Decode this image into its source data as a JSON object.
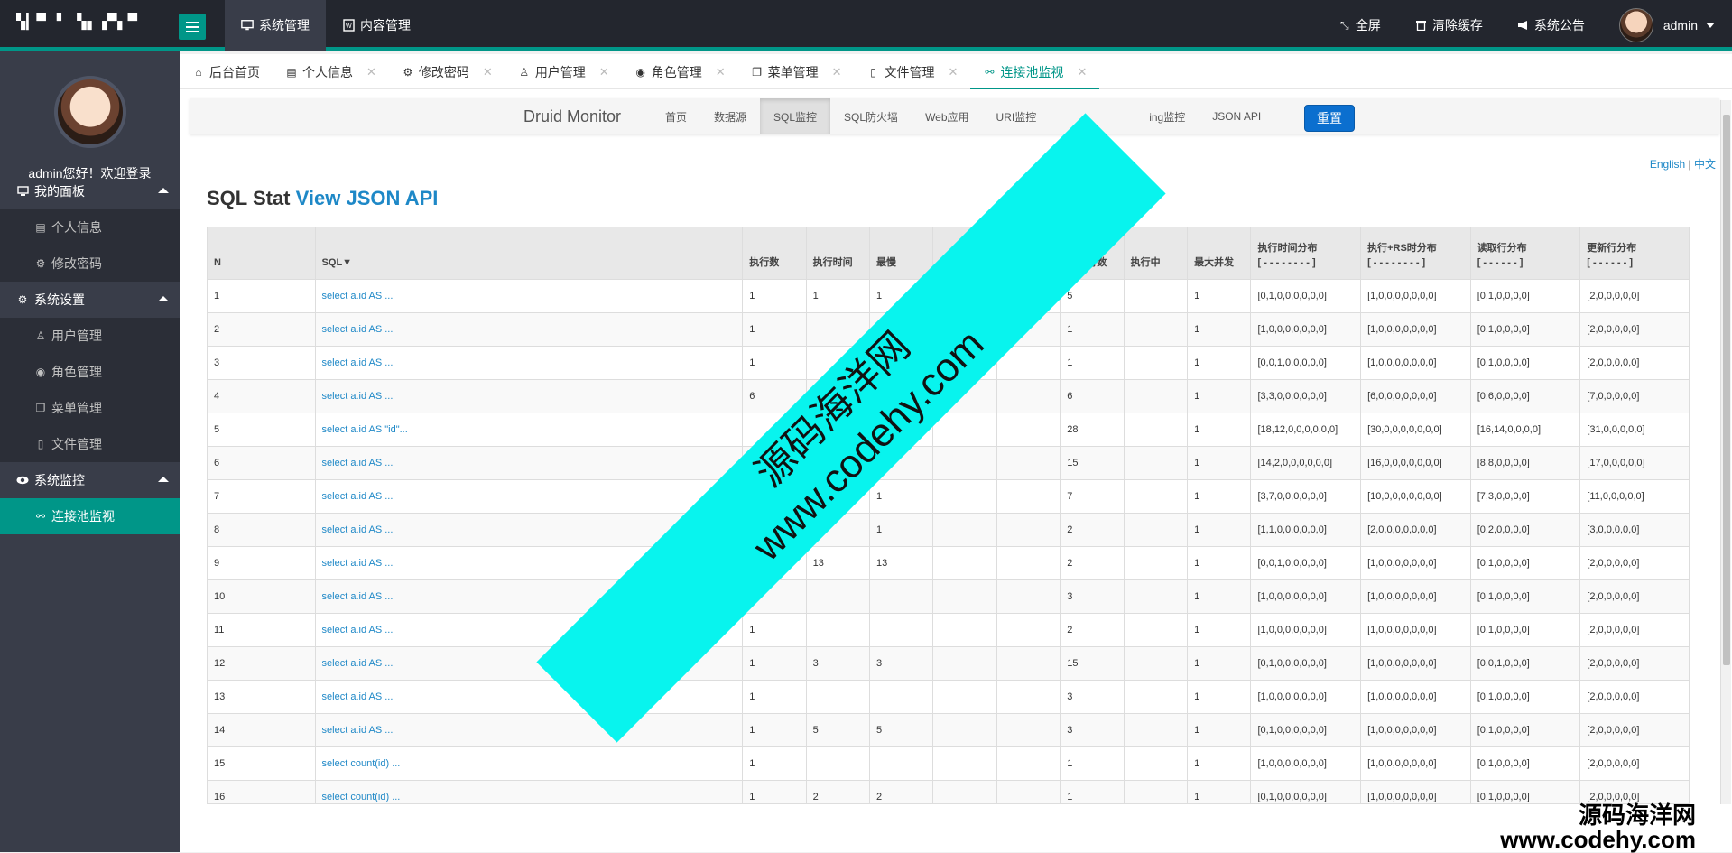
{
  "topbar": {
    "logo_text": "▚▎▀ ▘ ▚▖▗▀▖▀",
    "nav": [
      {
        "icon": "monitor-icon",
        "label": "系统管理",
        "active": true
      },
      {
        "icon": "word-doc-icon",
        "label": "内容管理",
        "active": false
      }
    ],
    "right": [
      {
        "icon": "fullscreen-icon",
        "label": "全屏"
      },
      {
        "icon": "trash-icon",
        "label": "清除缓存"
      },
      {
        "icon": "bullhorn-icon",
        "label": "系统公告"
      }
    ],
    "user": "admin"
  },
  "sidebar": {
    "welcome": "admin您好！欢迎登录",
    "groups": [
      {
        "icon": "desktop-icon",
        "label": "我的面板",
        "items": [
          {
            "icon": "id-card-icon",
            "label": "个人信息"
          },
          {
            "icon": "gear-icon",
            "label": "修改密码"
          }
        ]
      },
      {
        "icon": "gears-icon",
        "label": "系统设置",
        "items": [
          {
            "icon": "user-icon",
            "label": "用户管理"
          },
          {
            "icon": "user-circle-icon",
            "label": "角色管理"
          },
          {
            "icon": "window-restore-icon",
            "label": "菜单管理"
          },
          {
            "icon": "file-word-icon",
            "label": "文件管理"
          }
        ]
      },
      {
        "icon": "eye-icon",
        "label": "系统监控",
        "items": [
          {
            "icon": "connection-icon",
            "label": "连接池监视",
            "active": true
          }
        ]
      }
    ]
  },
  "tabs": [
    {
      "icon": "home-icon",
      "label": "后台首页",
      "closable": false
    },
    {
      "icon": "id-card-icon",
      "label": "个人信息",
      "closable": true
    },
    {
      "icon": "gear-icon",
      "label": "修改密码",
      "closable": true
    },
    {
      "icon": "user-icon",
      "label": "用户管理",
      "closable": true
    },
    {
      "icon": "user-circle-icon",
      "label": "角色管理",
      "closable": true
    },
    {
      "icon": "window-restore-icon",
      "label": "菜单管理",
      "closable": true
    },
    {
      "icon": "file-word-icon",
      "label": "文件管理",
      "closable": true
    },
    {
      "icon": "connection-icon",
      "label": "连接池监视",
      "closable": true,
      "active": true
    }
  ],
  "druid": {
    "brand": "Druid Monitor",
    "links": [
      "首页",
      "数据源",
      "SQL监控",
      "SQL防火墙",
      "Web应用",
      "URI监控",
      "",
      "ing监控",
      "JSON API"
    ],
    "active_link": "SQL监控",
    "reset": "重置",
    "lang_en": "English",
    "lang_sep": "|",
    "lang_zh": "中文",
    "title": "SQL Stat",
    "title_link": "View JSON API"
  },
  "sql_table": {
    "headers": [
      "N",
      "SQL▼",
      "执行数",
      "执行时间",
      "最慢",
      "",
      "",
      "读取行数",
      "执行中",
      "最大并发",
      "执行时间分布\n[ - - - - - - - - ]",
      "执行+RS时分布\n[ - - - - - - - - ]",
      "读取行分布\n[ - - - - - - ]",
      "更新行分布\n[ - - - - - - ]"
    ],
    "rows": [
      [
        "1",
        "select a.id AS ...",
        "1",
        "1",
        "1",
        "",
        "",
        "5",
        "",
        "1",
        "[0,1,0,0,0,0,0,0]",
        "[1,0,0,0,0,0,0,0]",
        "[0,1,0,0,0,0]",
        "[2,0,0,0,0,0]"
      ],
      [
        "2",
        "select a.id AS ...",
        "1",
        "",
        "",
        "",
        "",
        "1",
        "",
        "1",
        "[1,0,0,0,0,0,0,0]",
        "[1,0,0,0,0,0,0,0]",
        "[0,1,0,0,0,0]",
        "[2,0,0,0,0,0]"
      ],
      [
        "3",
        "select a.id AS ...",
        "1",
        "",
        "",
        "",
        "",
        "1",
        "",
        "1",
        "[0,0,1,0,0,0,0,0]",
        "[1,0,0,0,0,0,0,0]",
        "[0,1,0,0,0,0]",
        "[2,0,0,0,0,0]"
      ],
      [
        "4",
        "select a.id AS ...",
        "6",
        "",
        "",
        "",
        "",
        "6",
        "",
        "1",
        "[3,3,0,0,0,0,0,0]",
        "[6,0,0,0,0,0,0,0]",
        "[0,6,0,0,0,0]",
        "[7,0,0,0,0,0]"
      ],
      [
        "5",
        "select a.id AS \"id\"...",
        "",
        "",
        "",
        "",
        "",
        "28",
        "",
        "1",
        "[18,12,0,0,0,0,0,0]",
        "[30,0,0,0,0,0,0,0]",
        "[16,14,0,0,0,0]",
        "[31,0,0,0,0,0]"
      ],
      [
        "6",
        "select a.id AS ...",
        "",
        "",
        "",
        "",
        "",
        "15",
        "",
        "1",
        "[14,2,0,0,0,0,0,0]",
        "[16,0,0,0,0,0,0,0]",
        "[8,8,0,0,0,0]",
        "[17,0,0,0,0,0]"
      ],
      [
        "7",
        "select a.id AS ...",
        "",
        "",
        "1",
        "",
        "",
        "7",
        "",
        "1",
        "[3,7,0,0,0,0,0,0]",
        "[10,0,0,0,0,0,0,0]",
        "[7,3,0,0,0,0]",
        "[11,0,0,0,0,0]"
      ],
      [
        "8",
        "select a.id AS ...",
        "",
        "",
        "1",
        "",
        "",
        "2",
        "",
        "1",
        "[1,1,0,0,0,0,0,0]",
        "[2,0,0,0,0,0,0,0]",
        "[0,2,0,0,0,0]",
        "[3,0,0,0,0,0]"
      ],
      [
        "9",
        "select a.id AS ...",
        "",
        "13",
        "13",
        "",
        "",
        "2",
        "",
        "1",
        "[0,0,1,0,0,0,0,0]",
        "[1,0,0,0,0,0,0,0]",
        "[0,1,0,0,0,0]",
        "[2,0,0,0,0,0]"
      ],
      [
        "10",
        "select a.id AS ...",
        "1",
        "",
        "",
        "",
        "",
        "3",
        "",
        "1",
        "[1,0,0,0,0,0,0,0]",
        "[1,0,0,0,0,0,0,0]",
        "[0,1,0,0,0,0]",
        "[2,0,0,0,0,0]"
      ],
      [
        "11",
        "select a.id AS ...",
        "1",
        "",
        "",
        "",
        "",
        "2",
        "",
        "1",
        "[1,0,0,0,0,0,0,0]",
        "[1,0,0,0,0,0,0,0]",
        "[0,1,0,0,0,0]",
        "[2,0,0,0,0,0]"
      ],
      [
        "12",
        "select a.id AS ...",
        "1",
        "3",
        "3",
        "",
        "",
        "15",
        "",
        "1",
        "[0,1,0,0,0,0,0,0]",
        "[1,0,0,0,0,0,0,0]",
        "[0,0,1,0,0,0]",
        "[2,0,0,0,0,0]"
      ],
      [
        "13",
        "select a.id AS ...",
        "1",
        "",
        "",
        "",
        "",
        "3",
        "",
        "1",
        "[1,0,0,0,0,0,0,0]",
        "[1,0,0,0,0,0,0,0]",
        "[0,1,0,0,0,0]",
        "[2,0,0,0,0,0]"
      ],
      [
        "14",
        "select a.id AS ...",
        "1",
        "5",
        "5",
        "",
        "",
        "3",
        "",
        "1",
        "[0,1,0,0,0,0,0,0]",
        "[1,0,0,0,0,0,0,0]",
        "[0,1,0,0,0,0]",
        "[2,0,0,0,0,0]"
      ],
      [
        "15",
        "select count(id) ...",
        "1",
        "",
        "",
        "",
        "",
        "1",
        "",
        "1",
        "[1,0,0,0,0,0,0,0]",
        "[1,0,0,0,0,0,0,0]",
        "[0,1,0,0,0,0]",
        "[2,0,0,0,0,0]"
      ],
      [
        "16",
        "select count(id) ...",
        "1",
        "2",
        "2",
        "",
        "",
        "1",
        "",
        "1",
        "[0,1,0,0,0,0,0,0]",
        "[1,0,0,0,0,0,0,0]",
        "[0,1,0,0,0,0]",
        "[2,0,0,0,0,0]"
      ]
    ]
  },
  "watermark": {
    "line1": "源码海洋网",
    "line2": "www.codehy.com",
    "corner1": "源码海洋网",
    "corner2": "www.codehy.com",
    "color": "#08f4ee"
  },
  "colors": {
    "accent": "#009688",
    "topbar": "#23262e",
    "sidebar": "#393d49",
    "link": "#1e88c7",
    "button": "#0b6fcf"
  }
}
